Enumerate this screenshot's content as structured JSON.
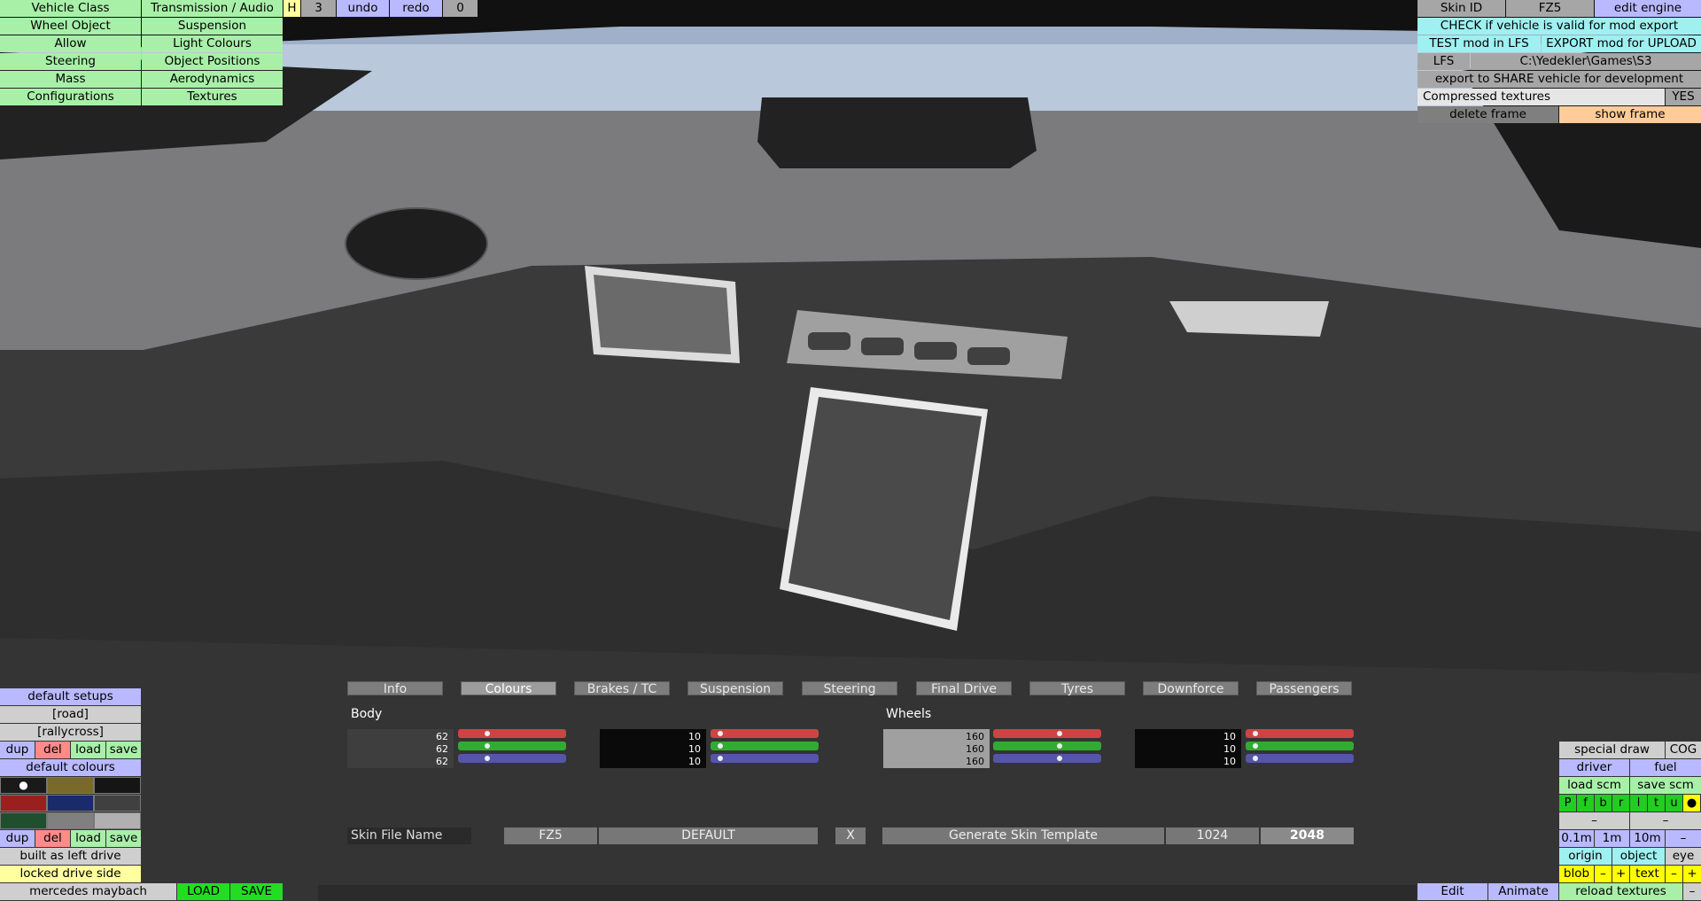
{
  "top_left_menu": {
    "col1": [
      "Vehicle Class",
      "Wheel Object",
      "Allow",
      "Steering",
      "Mass",
      "Configurations"
    ],
    "col2": [
      "Transmission / Audio",
      "Suspension",
      "Light Colours",
      "Object Positions",
      "Aerodynamics",
      "Textures"
    ],
    "h_label": "H",
    "h_value": "3",
    "undo": "undo",
    "redo": "redo",
    "redo_count": "0"
  },
  "top_right_panel": {
    "skin_id_label": "Skin ID",
    "skin_id_value": "FZ5",
    "edit_engine": "edit engine",
    "check_valid": "CHECK if vehicle is valid for mod export",
    "test_mod": "TEST mod in LFS",
    "export_mod": "EXPORT mod for UPLOAD",
    "lfs_label": "LFS",
    "lfs_path": "C:\\Yedekler\\Games\\S3",
    "export_share": "export to SHARE vehicle for development",
    "compressed_label": "Compressed textures",
    "compressed_value": "YES",
    "delete_frame": "delete frame",
    "show_frame": "show frame"
  },
  "tabs": [
    {
      "label": "Info",
      "active": false
    },
    {
      "label": "Colours",
      "active": true
    },
    {
      "label": "Brakes / TC",
      "active": false
    },
    {
      "label": "Suspension",
      "active": false
    },
    {
      "label": "Steering",
      "active": false
    },
    {
      "label": "Final Drive",
      "active": false
    },
    {
      "label": "Tyres",
      "active": false
    },
    {
      "label": "Downforce",
      "active": false
    },
    {
      "label": "Passengers",
      "active": false
    }
  ],
  "colours": {
    "body_label": "Body",
    "wheels_label": "Wheels",
    "body_primary": {
      "r": "62",
      "g": "62",
      "b": "62",
      "r_level": 0.24,
      "g_level": 0.24,
      "b_level": 0.24
    },
    "body_secondary": {
      "r": "10",
      "g": "10",
      "b": "10",
      "r_level": 0.04,
      "g_level": 0.04,
      "b_level": 0.04
    },
    "wheels_primary": {
      "r": "160",
      "g": "160",
      "b": "160",
      "r_level": 0.63,
      "g_level": 0.63,
      "b_level": 0.63
    },
    "wheels_secondary": {
      "r": "10",
      "g": "10",
      "b": "10",
      "r_level": 0.04,
      "g_level": 0.04,
      "b_level": 0.04
    }
  },
  "skin": {
    "file_name_label": "Skin File Name",
    "id": "FZ5",
    "name": "DEFAULT",
    "clear": "X",
    "generate": "Generate Skin Template",
    "size_1024": "1024",
    "size_2048": "2048"
  },
  "bottom_left": {
    "default_setups": "default setups",
    "road": "[road]",
    "rallycross": "[rallycross]",
    "dup": "dup",
    "del": "del",
    "load": "load",
    "save": "save",
    "default_colours": "default colours",
    "swatch_colors": [
      "#1a1a1a",
      "#7a6a2a",
      "#151515",
      "#9a2020",
      "#1a2a6a",
      "#404040",
      "#1f4f2f",
      "#808080",
      "#b0b0b0"
    ],
    "swatch_selected": "●",
    "built_as": "built as left drive",
    "locked_side": "locked drive side",
    "vehicle_name": "mercedes maybach",
    "load_btn": "LOAD",
    "save_btn": "SAVE"
  },
  "bottom_right": {
    "special_draw": "special draw",
    "cog": "COG",
    "driver": "driver",
    "fuel": "fuel",
    "load_scm": "load scm",
    "save_scm": "save scm",
    "flags": [
      "P",
      "f",
      "b",
      "r",
      "l",
      "t",
      "u",
      "●"
    ],
    "minus": "–",
    "step_01": "0.1m",
    "step_1": "1m",
    "step_10": "10m",
    "origin": "origin",
    "object": "object",
    "eye": "eye",
    "blob": "blob",
    "plus": "+",
    "text": "text",
    "edit": "Edit",
    "animate": "Animate",
    "reload": "reload textures"
  }
}
